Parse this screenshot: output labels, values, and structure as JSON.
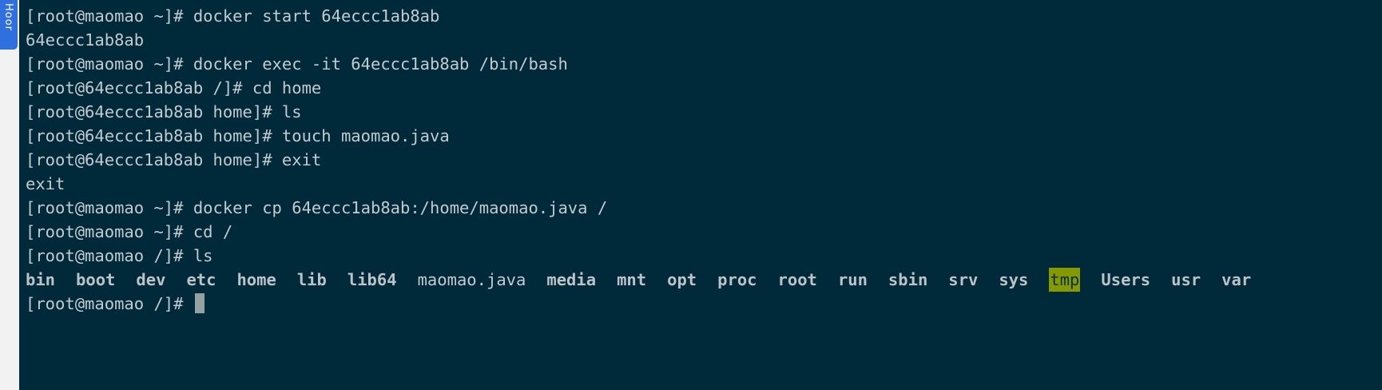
{
  "side_tab": {
    "label": "Hoor"
  },
  "terminal": {
    "lines": [
      "[root@maomao ~]# docker start 64eccc1ab8ab",
      "64eccc1ab8ab",
      "[root@maomao ~]# docker exec -it 64eccc1ab8ab /bin/bash",
      "[root@64eccc1ab8ab /]# cd home",
      "[root@64eccc1ab8ab home]# ls",
      "[root@64eccc1ab8ab home]# touch maomao.java",
      "[root@64eccc1ab8ab home]# exit",
      "exit",
      "[root@maomao ~]# docker cp 64eccc1ab8ab:/home/maomao.java /",
      "[root@maomao ~]# cd /",
      "[root@maomao /]# ls"
    ],
    "ls_entries": [
      {
        "name": "bin",
        "kind": "dir"
      },
      {
        "name": "boot",
        "kind": "dir"
      },
      {
        "name": "dev",
        "kind": "dir"
      },
      {
        "name": "etc",
        "kind": "dir"
      },
      {
        "name": "home",
        "kind": "dir"
      },
      {
        "name": "lib",
        "kind": "dir"
      },
      {
        "name": "lib64",
        "kind": "dir"
      },
      {
        "name": "maomao.java",
        "kind": "file"
      },
      {
        "name": "media",
        "kind": "dir"
      },
      {
        "name": "mnt",
        "kind": "dir"
      },
      {
        "name": "opt",
        "kind": "dir"
      },
      {
        "name": "proc",
        "kind": "dir"
      },
      {
        "name": "root",
        "kind": "dir"
      },
      {
        "name": "run",
        "kind": "dir"
      },
      {
        "name": "sbin",
        "kind": "dir"
      },
      {
        "name": "srv",
        "kind": "dir"
      },
      {
        "name": "sys",
        "kind": "dir"
      },
      {
        "name": "tmp",
        "kind": "sticky-dir"
      },
      {
        "name": "Users",
        "kind": "dir"
      },
      {
        "name": "usr",
        "kind": "dir"
      },
      {
        "name": "var",
        "kind": "dir"
      }
    ],
    "prompt": "[root@maomao /]# ",
    "colors": {
      "background": "#00293a",
      "foreground": "#c2cbcf",
      "sticky_dir_bg": "#859900",
      "cursor": "#93a1a1"
    }
  }
}
